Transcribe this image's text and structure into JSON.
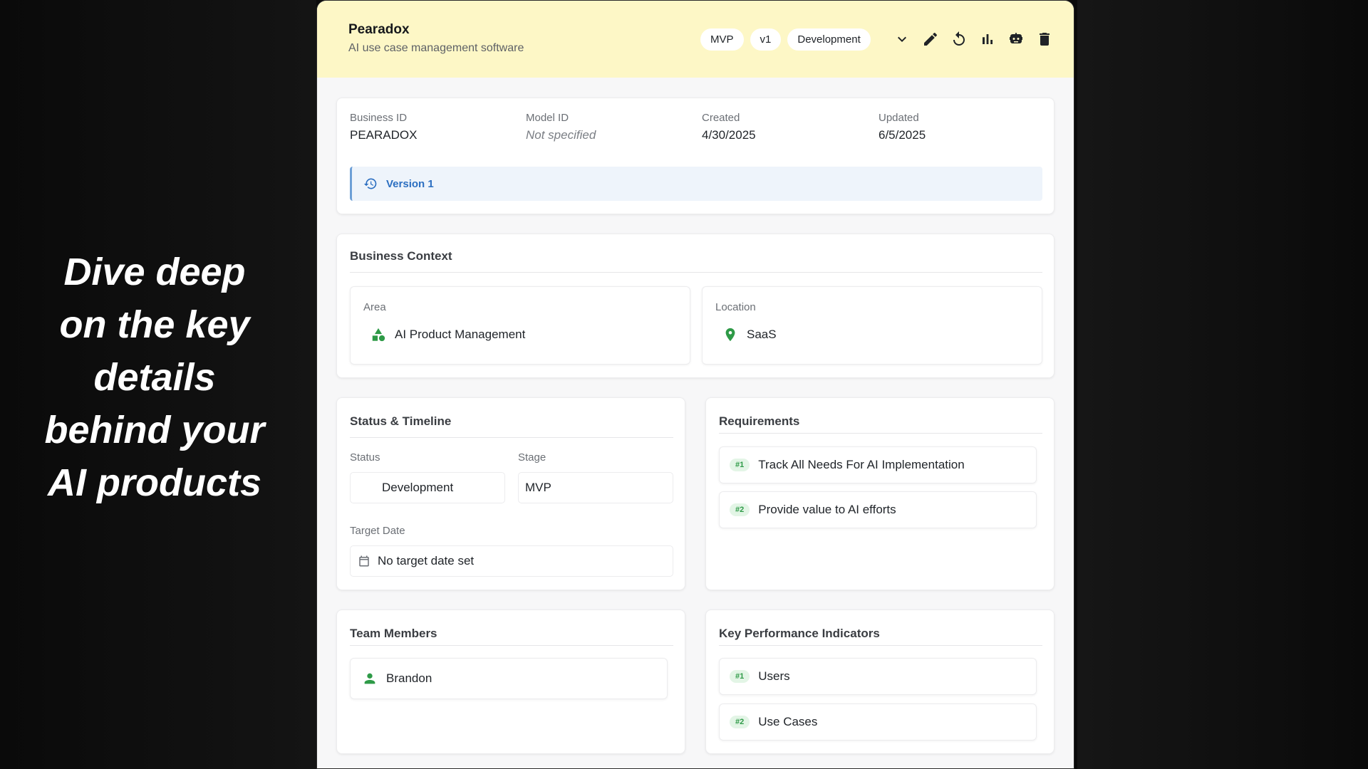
{
  "tagline": {
    "lines": [
      "Dive deep",
      "on the key",
      "details",
      "behind your",
      "AI products"
    ]
  },
  "header": {
    "title": "Pearadox",
    "subtitle": "AI use case management software",
    "chips": [
      "MVP",
      "v1",
      "Development"
    ],
    "icons": [
      "chevron-down-icon",
      "edit-icon",
      "refresh-icon",
      "bar-chart-icon",
      "robot-icon",
      "trash-icon"
    ],
    "background_color": "#fdf7c6"
  },
  "meta": {
    "business_id_label": "Business ID",
    "business_id_value": "PEARADOX",
    "model_id_label": "Model ID",
    "model_id_value": "Not specified",
    "created_label": "Created",
    "created_value": "4/30/2025",
    "updated_label": "Updated",
    "updated_value": "6/5/2025",
    "version_label": "Version 1"
  },
  "business_context": {
    "title": "Business Context",
    "area_label": "Area",
    "area_value": "AI Product Management",
    "location_label": "Location",
    "location_value": "SaaS"
  },
  "status_timeline": {
    "title": "Status & Timeline",
    "status_label": "Status",
    "status_value": "Development",
    "stage_label": "Stage",
    "stage_value": "MVP",
    "target_date_label": "Target Date",
    "target_date_value": "No target date set"
  },
  "requirements": {
    "title": "Requirements",
    "items": [
      {
        "badge": "#1",
        "text": "Track All Needs For AI Implementation"
      },
      {
        "badge": "#2",
        "text": "Provide value to AI efforts"
      }
    ]
  },
  "team": {
    "title": "Team Members",
    "members": [
      "Brandon"
    ]
  },
  "kpis": {
    "title": "Key Performance Indicators",
    "items": [
      {
        "badge": "#1",
        "text": "Users"
      },
      {
        "badge": "#2",
        "text": "Use Cases"
      }
    ]
  },
  "colors": {
    "accent_green": "#2e9a47",
    "accent_blue": "#2c6fc1"
  }
}
